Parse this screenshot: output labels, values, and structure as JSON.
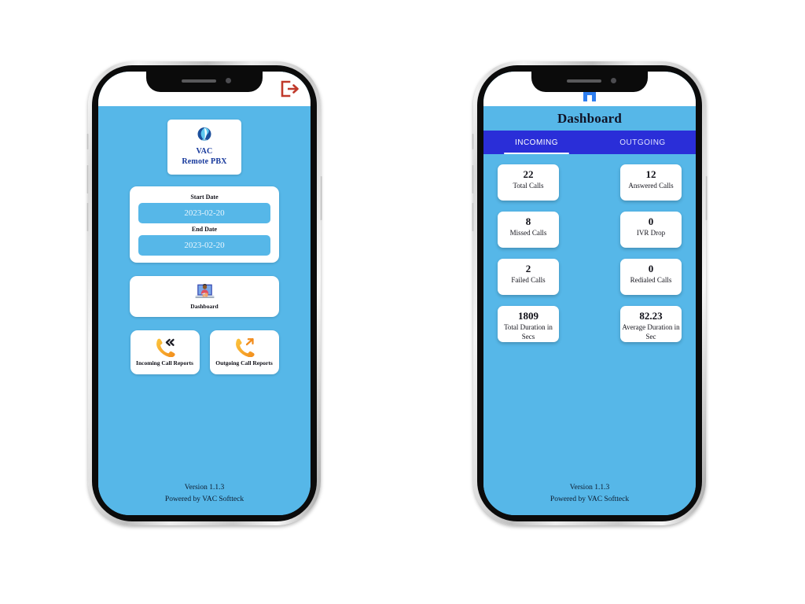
{
  "phones": {
    "left": {
      "topbar": {
        "logout_icon": "logout-icon"
      },
      "brand": {
        "logo_icon": "vac-globe-logo-icon",
        "name": "VAC",
        "subtitle": "Remote PBX"
      },
      "date_filter": {
        "start_label": "Start Date",
        "start_value": "2023-02-20",
        "end_label": "End Date",
        "end_value": "2023-02-20"
      },
      "tiles": [
        {
          "icon": "dashboard-person-laptop-icon",
          "label": "Dashboard"
        },
        {
          "icon": "incoming-call-icon",
          "label": "Incoming Call Reports"
        },
        {
          "icon": "outgoing-call-icon",
          "label": "Outgoing Call Reports"
        }
      ],
      "footer": {
        "version": "Version 1.1.3",
        "powered_by": "Powered by VAC Softteck"
      }
    },
    "right": {
      "topbar": {
        "home_icon": "home-icon"
      },
      "title": "Dashboard",
      "tabs": [
        {
          "label": "INCOMING",
          "active": true
        },
        {
          "label": "OUTGOING",
          "active": false
        }
      ],
      "stats": [
        {
          "value": "22",
          "label": "Total Calls"
        },
        {
          "value": "12",
          "label": "Answered Calls"
        },
        {
          "value": "8",
          "label": "Missed Calls"
        },
        {
          "value": "0",
          "label": "IVR Drop"
        },
        {
          "value": "2",
          "label": "Failed Calls"
        },
        {
          "value": "0",
          "label": "Redialed Calls"
        },
        {
          "value": "1809",
          "label": "Total Duration in Secs"
        },
        {
          "value": "82.23",
          "label": "Average Duration in Sec"
        }
      ],
      "footer": {
        "version": "Version 1.1.3",
        "powered_by": "Powered by VAC Softteck"
      }
    }
  },
  "colors": {
    "screen_bg": "#56b7e8",
    "tabbar": "#2a2ed8",
    "brand_text": "#15379b",
    "logout": "#c0392b",
    "call_icon": "#f5a623",
    "home_icon": "#2e7ef0"
  }
}
